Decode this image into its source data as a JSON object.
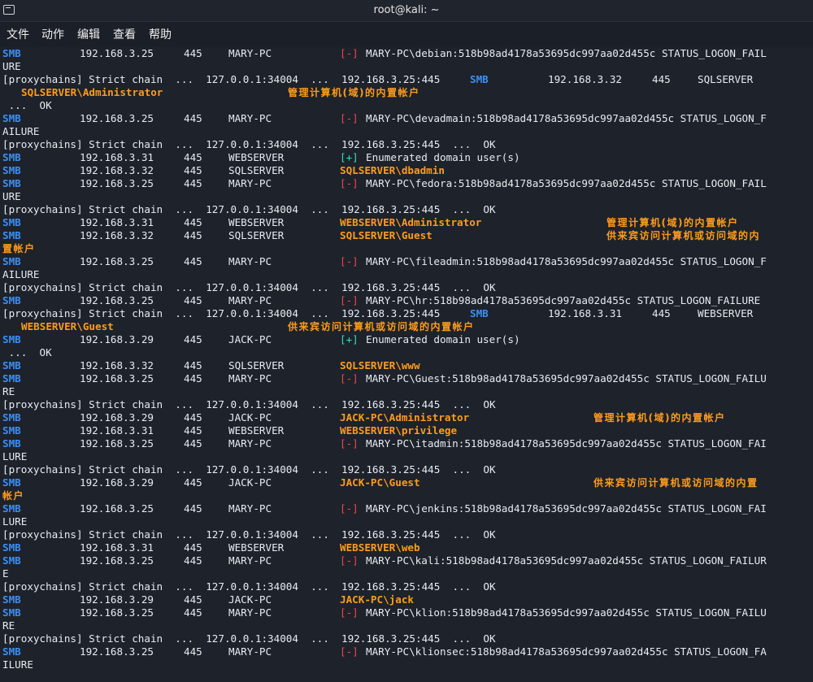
{
  "window": {
    "title": "root@kali: ~"
  },
  "menu": [
    "文件",
    "动作",
    "编辑",
    "查看",
    "帮助"
  ],
  "colors": {
    "smb": "#3d8ff5",
    "fail": "#f04747",
    "ok": "#33e0b8",
    "account": "#ff9c1a",
    "text": "#e9ecef",
    "background": "#1d222b"
  },
  "lines": [
    [
      "SMB",
      "192.168.3.25",
      "445",
      "MARY-PC",
      "[-]",
      "MARY-PC\\debian:518b98ad4178a53695dc997aa02d455c STATUS_LOGON_FAIL"
    ],
    [
      "URE"
    ],
    [
      "[proxychains] Strict chain  ...  127.0.0.1:34004  ...  192.168.3.25:445",
      "SMB",
      "192.168.3.32",
      "445",
      "SQLSERVER"
    ],
    [
      "SQLSERVER\\Administrator",
      "管理计算机(域)的内置帐户"
    ],
    [
      " ...  OK"
    ],
    [
      "SMB",
      "192.168.3.25",
      "445",
      "MARY-PC",
      "[-]",
      "MARY-PC\\devadmain:518b98ad4178a53695dc997aa02d455c STATUS_LOGON_F"
    ],
    [
      "AILURE"
    ],
    [
      "[proxychains] Strict chain  ...  127.0.0.1:34004  ...  192.168.3.25:445  ...  OK"
    ],
    [
      "SMB",
      "192.168.3.31",
      "445",
      "WEBSERVER",
      "[+]",
      "Enumerated domain user(s)"
    ],
    [
      "SMB",
      "192.168.3.32",
      "445",
      "SQLSERVER",
      "SQLSERVER\\dbadmin"
    ],
    [
      "SMB",
      "192.168.3.25",
      "445",
      "MARY-PC",
      "[-]",
      "MARY-PC\\fedora:518b98ad4178a53695dc997aa02d455c STATUS_LOGON_FAIL"
    ],
    [
      "URE"
    ],
    [
      "[proxychains] Strict chain  ...  127.0.0.1:34004  ...  192.168.3.25:445  ...  OK"
    ],
    [
      "SMB",
      "192.168.3.31",
      "445",
      "WEBSERVER",
      "WEBSERVER\\Administrator",
      "管理计算机(域)的内置帐户"
    ],
    [
      "SMB",
      "192.168.3.32",
      "445",
      "SQLSERVER",
      "SQLSERVER\\Guest",
      "供来宾访问计算机或访问域的内"
    ],
    [
      "置帐户"
    ],
    [
      "SMB",
      "192.168.3.25",
      "445",
      "MARY-PC",
      "[-]",
      "MARY-PC\\fileadmin:518b98ad4178a53695dc997aa02d455c STATUS_LOGON_F"
    ],
    [
      "AILURE"
    ],
    [
      "[proxychains] Strict chain  ...  127.0.0.1:34004  ...  192.168.3.25:445  ...  OK"
    ],
    [
      "SMB",
      "192.168.3.25",
      "445",
      "MARY-PC",
      "[-]",
      "MARY-PC\\hr:518b98ad4178a53695dc997aa02d455c STATUS_LOGON_FAILURE"
    ],
    [
      "[proxychains] Strict chain  ...  127.0.0.1:34004  ...  192.168.3.25:445",
      "SMB",
      "192.168.3.31",
      "445",
      "WEBSERVER"
    ],
    [
      "WEBSERVER\\Guest",
      "供来宾访问计算机或访问域的内置帐户"
    ],
    [
      "SMB",
      "192.168.3.29",
      "445",
      "JACK-PC",
      "[+]",
      "Enumerated domain user(s)"
    ],
    [
      " ...  OK"
    ],
    [
      "SMB",
      "192.168.3.32",
      "445",
      "SQLSERVER",
      "SQLSERVER\\www"
    ],
    [
      "SMB",
      "192.168.3.25",
      "445",
      "MARY-PC",
      "[-]",
      "MARY-PC\\Guest:518b98ad4178a53695dc997aa02d455c STATUS_LOGON_FAILU"
    ],
    [
      "RE"
    ],
    [
      "[proxychains] Strict chain  ...  127.0.0.1:34004  ...  192.168.3.25:445  ...  OK"
    ],
    [
      "SMB",
      "192.168.3.29",
      "445",
      "JACK-PC",
      "JACK-PC\\Administrator",
      "管理计算机(域)的内置帐户"
    ],
    [
      "SMB",
      "192.168.3.31",
      "445",
      "WEBSERVER",
      "WEBSERVER\\privilege"
    ],
    [
      "SMB",
      "192.168.3.25",
      "445",
      "MARY-PC",
      "[-]",
      "MARY-PC\\itadmin:518b98ad4178a53695dc997aa02d455c STATUS_LOGON_FAI"
    ],
    [
      "LURE"
    ],
    [
      "[proxychains] Strict chain  ...  127.0.0.1:34004  ...  192.168.3.25:445  ...  OK"
    ],
    [
      "SMB",
      "192.168.3.29",
      "445",
      "JACK-PC",
      "JACK-PC\\Guest",
      "供来宾访问计算机或访问域的内置"
    ],
    [
      "帐户"
    ],
    [
      "SMB",
      "192.168.3.25",
      "445",
      "MARY-PC",
      "[-]",
      "MARY-PC\\jenkins:518b98ad4178a53695dc997aa02d455c STATUS_LOGON_FAI"
    ],
    [
      "LURE"
    ],
    [
      "[proxychains] Strict chain  ...  127.0.0.1:34004  ...  192.168.3.25:445  ...  OK"
    ],
    [
      "SMB",
      "192.168.3.31",
      "445",
      "WEBSERVER",
      "WEBSERVER\\web"
    ],
    [
      "SMB",
      "192.168.3.25",
      "445",
      "MARY-PC",
      "[-]",
      "MARY-PC\\kali:518b98ad4178a53695dc997aa02d455c STATUS_LOGON_FAILUR"
    ],
    [
      "E"
    ],
    [
      "[proxychains] Strict chain  ...  127.0.0.1:34004  ...  192.168.3.25:445  ...  OK"
    ],
    [
      "SMB",
      "192.168.3.29",
      "445",
      "JACK-PC",
      "JACK-PC\\jack"
    ],
    [
      "SMB",
      "192.168.3.25",
      "445",
      "MARY-PC",
      "[-]",
      "MARY-PC\\klion:518b98ad4178a53695dc997aa02d455c STATUS_LOGON_FAILU"
    ],
    [
      "RE"
    ],
    [
      "[proxychains] Strict chain  ...  127.0.0.1:34004  ...  192.168.3.25:445  ...  OK"
    ],
    [
      "SMB",
      "192.168.3.25",
      "445",
      "MARY-PC",
      "[-]",
      "MARY-PC\\klionsec:518b98ad4178a53695dc997aa02d455c STATUS_LOGON_FA"
    ],
    [
      "ILURE"
    ]
  ]
}
